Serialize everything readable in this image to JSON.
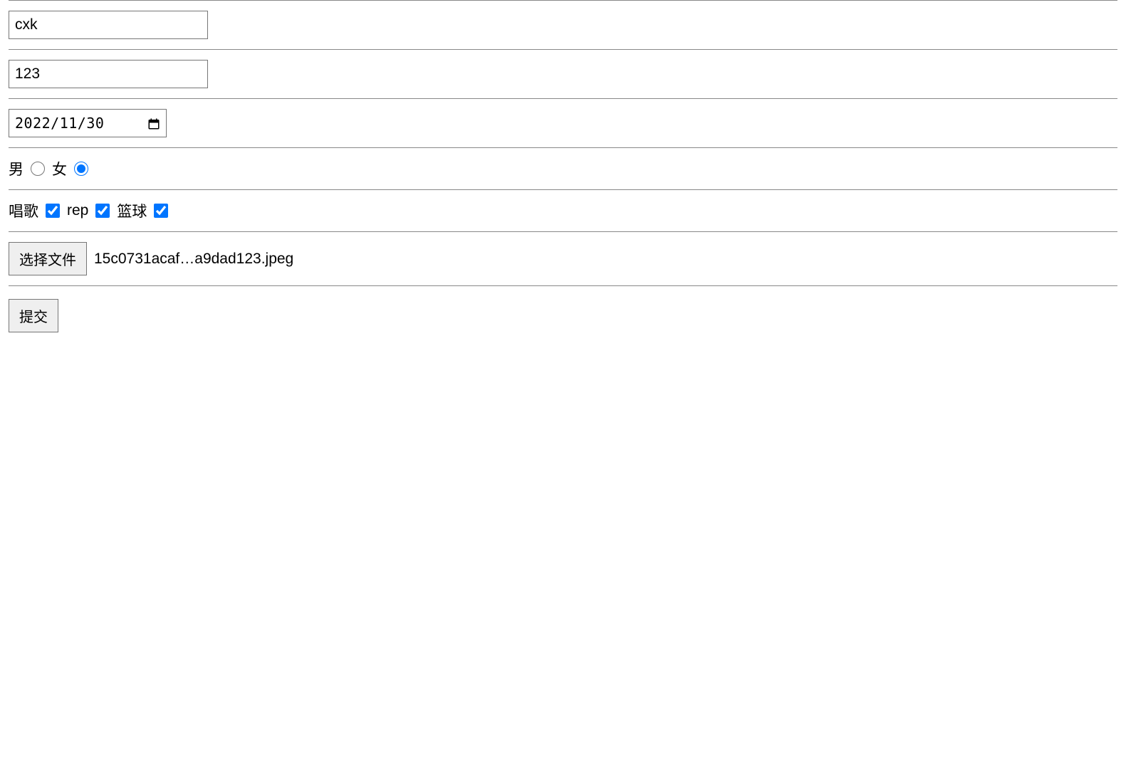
{
  "name": {
    "value": "cxk"
  },
  "password": {
    "value": "123"
  },
  "date": {
    "display": "2022/11/30"
  },
  "gender": {
    "options": [
      {
        "label": "男",
        "checked": false
      },
      {
        "label": "女",
        "checked": true
      }
    ]
  },
  "hobbies": {
    "options": [
      {
        "label": "唱歌",
        "checked": true
      },
      {
        "label": "rep",
        "checked": true
      },
      {
        "label": "篮球",
        "checked": true
      }
    ]
  },
  "file": {
    "button_label": "选择文件",
    "file_name": "15c0731acaf…a9dad123.jpeg"
  },
  "submit": {
    "label": "提交"
  }
}
